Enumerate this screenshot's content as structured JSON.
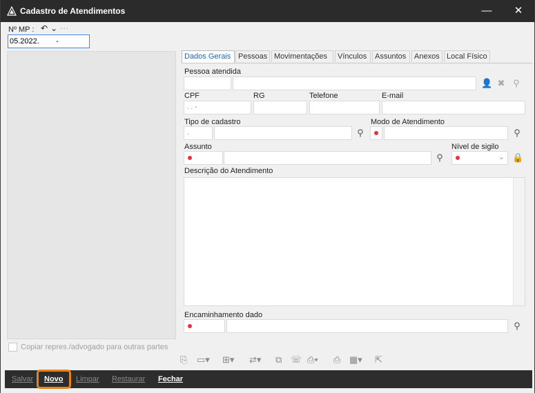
{
  "window": {
    "title": "Cadastro de Atendimentos",
    "minimize": "—",
    "close": "✕"
  },
  "mp": {
    "label": "Nº MP :",
    "value": "05.2022.        -",
    "icons": [
      "undo-icon",
      "chevron-down-icon",
      "more-icon"
    ]
  },
  "copy_checkbox": {
    "label": "Copiar repres./advogado para outras partes",
    "checked": false
  },
  "tabs": [
    "Dados Gerais",
    "Pessoas",
    "Movimentações",
    "Vínculos",
    "Assuntos",
    "Anexos",
    "Local Físico"
  ],
  "form": {
    "pessoa_atendida": "Pessoa atendida",
    "cpf": "CPF",
    "cpf_value": ".  .  -",
    "rg": "RG",
    "telefone": "Telefone",
    "email": "E-mail",
    "tipo_cadastro": "Tipo de cadastro",
    "tipo_cadastro_value": ".",
    "modo_atendimento": "Modo de Atendimento",
    "assunto": "Assunto",
    "nivel_sigilo": "Nível de sigilo",
    "descricao": "Descrição do Atendimento",
    "encaminhamento": "Encaminhamento dado"
  },
  "bottom_buttons": [
    "Salvar",
    "Novo",
    "Limpar",
    "Restaurar",
    "Fechar"
  ],
  "colors": {
    "titlebar": "#2b2b2b",
    "accent": "#1a64b4",
    "required": "#e8333c",
    "highlight": "#e8821a"
  }
}
